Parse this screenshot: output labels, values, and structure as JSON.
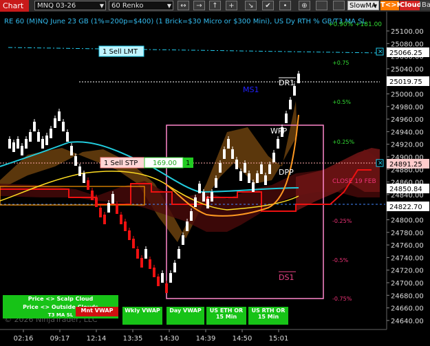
{
  "toolbar": {
    "chart_label": "Chart",
    "instrument": "MNQ 03-26",
    "period": "60 Renko",
    "buttons": [
      "↔",
      "→",
      "↑",
      "+",
      "↘",
      "✔",
      "•",
      "⊕"
    ],
    "indicator": "SlowMA",
    "t_cloud": "T<>K",
    "cloud": "Cloud",
    "bar": "Bar"
  },
  "header": {
    "title": "RE 60 (M)NQ June 23 GB (1%=200p=$400) (1 Brick=$30 Micro or $300 Mini), US Dy RTH % GB/T3 MA SL",
    "topright": "+0.90% +181.00"
  },
  "price_axis": {
    "ticks": [
      "25100.00",
      "25080.00",
      "25060.00",
      "25040.00",
      "25020.00",
      "25000.00",
      "24980.00",
      "24960.00",
      "24940.00",
      "24920.00",
      "24900.00",
      "24880.00",
      "24860.00",
      "24840.00",
      "24820.00",
      "24800.00",
      "24780.00",
      "24760.00",
      "24740.00",
      "24720.00",
      "24700.00",
      "24680.00",
      "24660.00",
      "24640.00"
    ],
    "tags": [
      {
        "text": "25066.25",
        "color": "#ffffff",
        "fg": "#000"
      },
      {
        "text": "25019.75",
        "color": "#ffffff",
        "fg": "#000"
      },
      {
        "text": "24891.25",
        "color": "#ffcccc",
        "fg": "#000"
      },
      {
        "text": "24850.84",
        "color": "#ffffff",
        "fg": "#000"
      },
      {
        "text": "24822.70",
        "color": "#ffffff",
        "fg": "#000"
      }
    ]
  },
  "time_axis": [
    "02:16",
    "09:17",
    "12:14",
    "13:35",
    "14:30",
    "14:39",
    "14:50",
    "15:01"
  ],
  "orders": {
    "sell_lmt": "1 Sell LMT",
    "sell_stp": "1 Sell STP",
    "stp_value": "169.00",
    "stp_qty": "1"
  },
  "levels": {
    "ms1": "MS1",
    "dr1": "DR1",
    "wpp": "WPP",
    "dpp": "DPP",
    "ds1": "DS1",
    "close": "CLOSE 19 FEB"
  },
  "percent_labels": [
    {
      "text": "+0.75",
      "color": "#33dd33"
    },
    {
      "text": "+0.5%",
      "color": "#33dd33"
    },
    {
      "text": "+0.25%",
      "color": "#33dd33"
    },
    {
      "text": "-0.25%",
      "color": "#ee3377"
    },
    {
      "text": "-0.5%",
      "color": "#ee3377"
    },
    {
      "text": "-0.75%",
      "color": "#ee3377"
    }
  ],
  "legend": {
    "scalp": "Price <> Scalp Cloud",
    "outside": "Price <> Outside Clouds",
    "t3": "T3 MA SL",
    "mnt_vwap": "Mnt VWAP",
    "wkly_vwap": "Wkly VWAP",
    "day_vwap": "Day VWAP",
    "eth_or": "US ETH OR 15 Min",
    "rth_or": "US RTH OR 15 Min"
  },
  "copyright": "© 2026 NinjaTrader, LLC",
  "colors": {
    "price_line": "#33bbee",
    "green_btn": "#17c317",
    "red_btn": "#d01010",
    "pink_box": "#ff88cc"
  }
}
